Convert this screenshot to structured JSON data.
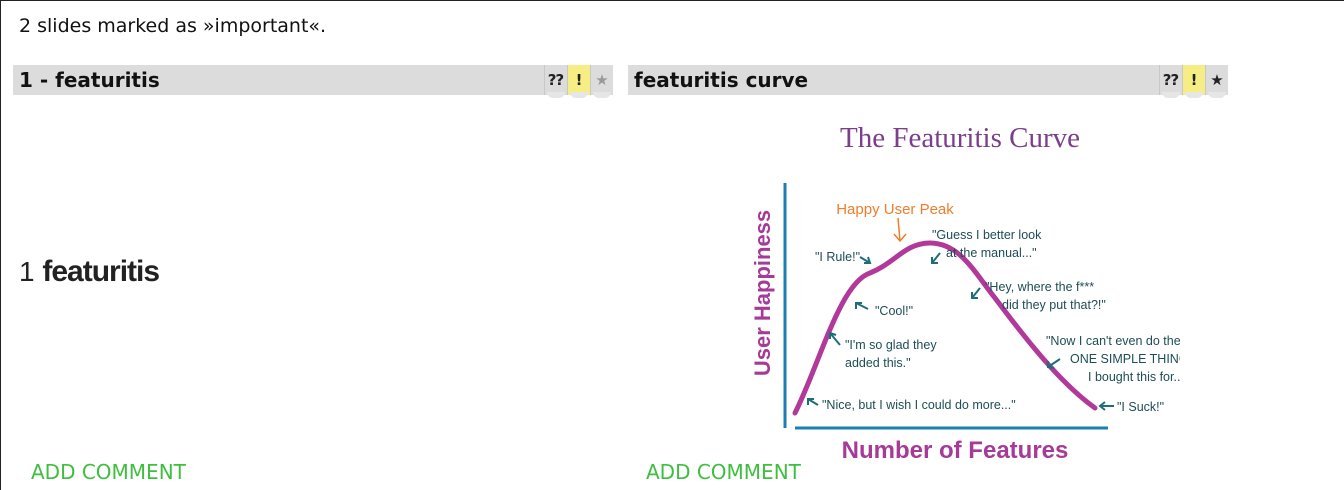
{
  "summary": "2 slides marked as »important«.",
  "slides": [
    {
      "title": "1 - featuritis",
      "markers": {
        "question": "⁇",
        "important": "!",
        "star": "★"
      },
      "body_number": "1",
      "body_word": "featuritis",
      "comment_label": "ADD COMMENT"
    },
    {
      "title": "featuritis curve",
      "markers": {
        "question": "⁇",
        "important": "!",
        "star": "★"
      },
      "comment_label": "ADD COMMENT"
    }
  ],
  "colors": {
    "important_marker": "#f6ee84",
    "comment_link": "#3fbf3f",
    "curve": "#b0399a",
    "axis": "#1c7fb0",
    "annotation": "#1d6e78",
    "peak_label": "#f07d2b"
  },
  "figure": {
    "title": "The Featuritis Curve",
    "ylabel": "User Happiness",
    "xlabel": "Number of Features",
    "peak_label": "Happy User Peak",
    "annotations": [
      "\"I Rule!\"",
      "\"Guess I better look",
      "at the manual...\"",
      "\"Cool!\"",
      "\"Hey, where the f***",
      "did they put that?!\"",
      "\"I'm so glad they",
      "added this.\"",
      "\"Now I can't even do the",
      "ONE SIMPLE THING",
      "I bought this for...\"",
      "\"Nice, but I wish I could do more...\"",
      "\"I Suck!\""
    ]
  }
}
